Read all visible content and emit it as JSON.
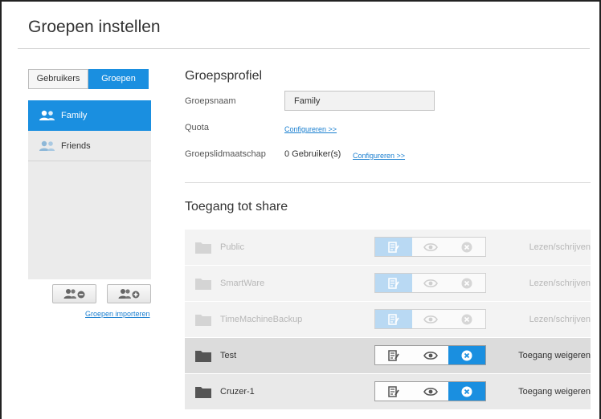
{
  "page": {
    "title": "Groepen instellen"
  },
  "left": {
    "tabs": [
      {
        "label": "Gebruikers",
        "active": false
      },
      {
        "label": "Groepen",
        "active": true
      }
    ],
    "groups": [
      {
        "name": "Family",
        "selected": true
      },
      {
        "name": "Friends",
        "selected": false
      }
    ],
    "buttons": {
      "remove": "remove-group-icon",
      "add": "add-group-icon"
    },
    "import_link": "Groepen importeren"
  },
  "profile": {
    "title": "Groepsprofiel",
    "name_label": "Groepsnaam",
    "name_value": "Family",
    "quota_label": "Quota",
    "quota_link": "Configureren >>",
    "membership_label": "Groepslidmaatschap",
    "membership_value": "0 Gebruiker(s)",
    "membership_link": "Configureren >>"
  },
  "access": {
    "title": "Toegang tot share",
    "shares": [
      {
        "name": "Public",
        "enabled": false,
        "permission": "read-write",
        "status": "Lezen/schrijven"
      },
      {
        "name": "SmartWare",
        "enabled": false,
        "permission": "read-write",
        "status": "Lezen/schrijven"
      },
      {
        "name": "TimeMachineBackup",
        "enabled": false,
        "permission": "read-write",
        "status": "Lezen/schrijven"
      },
      {
        "name": "Test",
        "enabled": true,
        "permission": "deny",
        "status": "Toegang weigeren"
      },
      {
        "name": "Cruzer-1",
        "enabled": true,
        "permission": "deny",
        "status": "Toegang weigeren"
      }
    ]
  },
  "colors": {
    "accent": "#1a8fe0",
    "accent_light": "#b9d9f3"
  }
}
